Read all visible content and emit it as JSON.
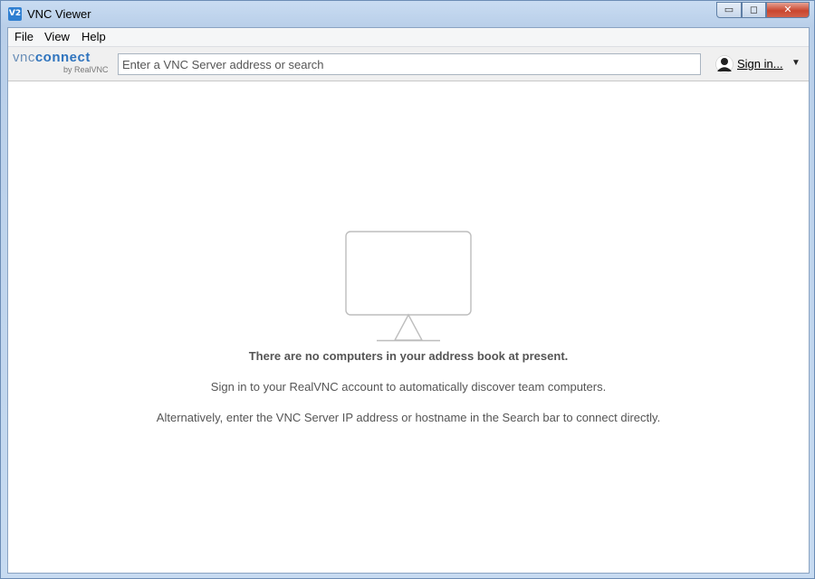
{
  "window": {
    "title": "VNC Viewer",
    "app_icon_text": "V2",
    "controls": {
      "minimize": "▭",
      "maximize": "◻",
      "close": "✕"
    }
  },
  "menu": {
    "items": [
      {
        "label": "File"
      },
      {
        "label": "View"
      },
      {
        "label": "Help"
      }
    ]
  },
  "toolbar": {
    "logo": {
      "vnc": "vnc",
      "connect": "connect",
      "sub": "by RealVNC"
    },
    "search": {
      "value": "",
      "placeholder": "Enter a VNC Server address or search"
    },
    "sign_in": {
      "label": "Sign in...",
      "caret": "▼",
      "icon": "user-icon"
    }
  },
  "empty_state": {
    "icon": "monitor-icon",
    "heading": "There are no computers in your address book at present.",
    "line1": "Sign in to your RealVNC account to automatically discover team computers.",
    "line2": "Alternatively, enter the VNC Server IP address or hostname in the Search bar to connect directly."
  },
  "colors": {
    "accent": "#2f74be",
    "frame": "#c9dcf2",
    "close_button": "#c9462f",
    "muted_text": "#555555"
  }
}
